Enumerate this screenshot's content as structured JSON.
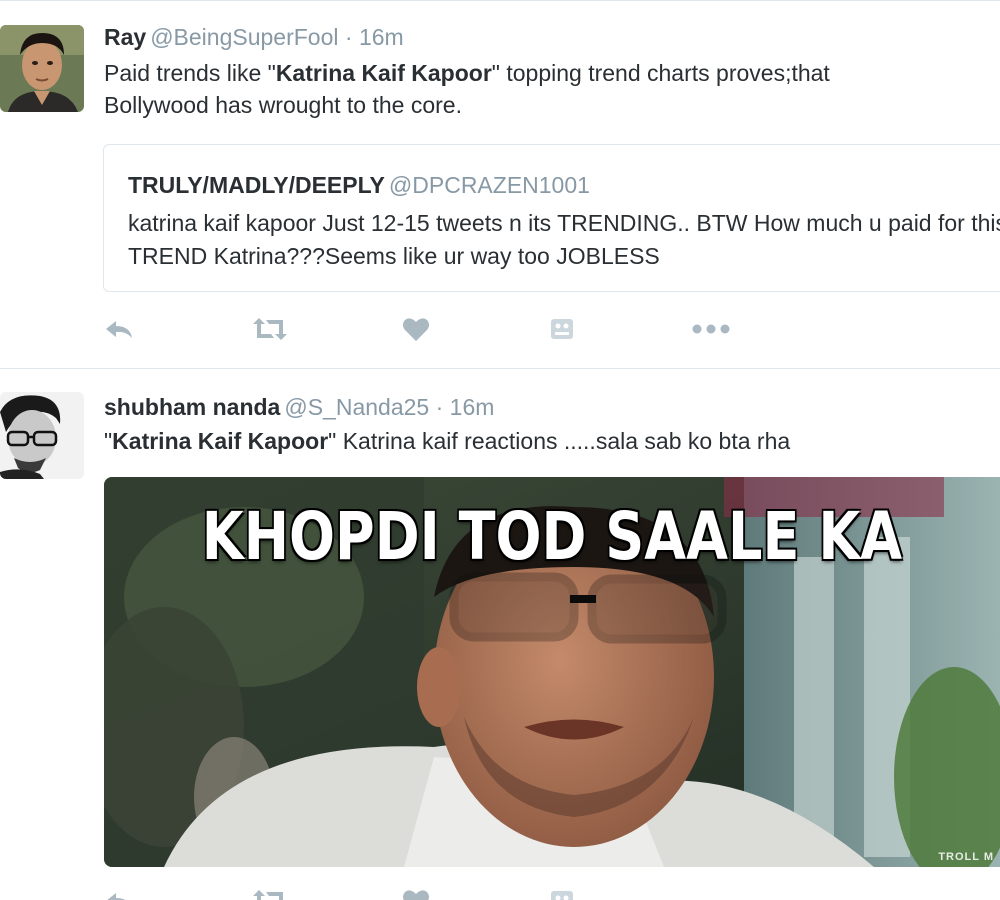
{
  "tweets": [
    {
      "name": "Ray",
      "handle": "@BeingSuperFool",
      "dot": "·",
      "time": "16m",
      "text": {
        "before": "Paid trends like \"",
        "bold": "Katrina Kaif Kapoor",
        "after": "\" topping trend charts proves;that",
        "line2": "Bollywood has wrought to the core."
      },
      "quote": {
        "name": "TRULY/MADLY/DEEPLY",
        "handle": "@DPCRAZEN1001",
        "text": "katrina kaif kapoor  Just 12-15 tweets n its TRENDING.. BTW How much u paid for this TREND Katrina???Seems like ur way too JOBLESS"
      },
      "actions": [
        "reply-icon",
        "retweet-icon",
        "like-icon",
        "moments-icon",
        "more-icon"
      ]
    },
    {
      "name": "shubham nanda",
      "handle": "@S_Nanda25",
      "dot": "·",
      "time": "16m",
      "text": {
        "before": "\"",
        "bold": "Katrina Kaif Kapoor",
        "after": "\" Katrina kaif reactions .....sala sab ko bta rha"
      },
      "media": {
        "caption": "KHOPDI TOD SAALE KA",
        "watermark": "TROLL M"
      },
      "actions": [
        "reply-icon",
        "retweet-icon",
        "like-icon",
        "moments-icon",
        "more-icon"
      ]
    }
  ],
  "colors": {
    "text": "#292f33",
    "muted": "#8899a6",
    "icon": "#aab8c2",
    "border": "#e1e8ed"
  }
}
